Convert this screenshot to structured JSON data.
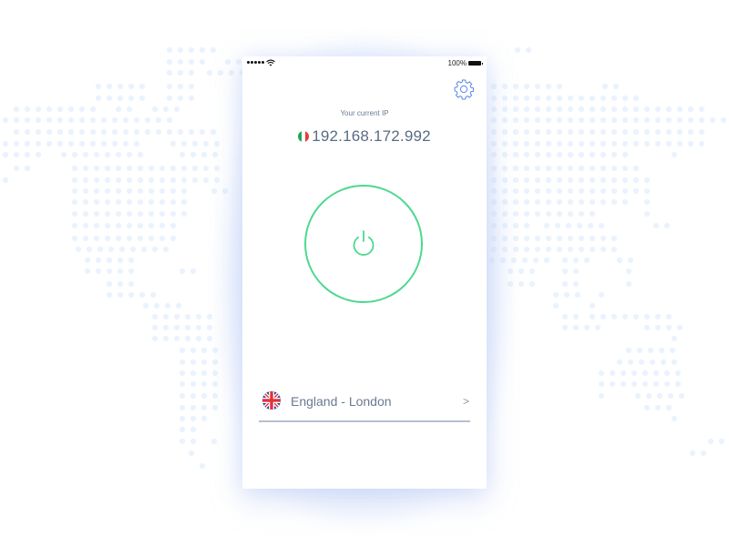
{
  "status_bar": {
    "signal_dots": 5,
    "wifi_icon": "wifi-icon",
    "battery_percent": "100%",
    "battery_icon": "battery-full-icon"
  },
  "header": {
    "settings_icon": "gear-icon"
  },
  "ip": {
    "label": "Your current IP",
    "country_flag": "italy-flag",
    "value": "192.168.172.992"
  },
  "connection": {
    "power_icon": "power-icon",
    "accent_color": "#4dd88f"
  },
  "location": {
    "flag": "united-kingdom-flag",
    "name": "England - London",
    "chevron": "chevron-right-icon",
    "chevron_glyph": ">"
  },
  "background": {
    "type": "dotted-world-map",
    "dot_color": "#eaf3fd"
  }
}
